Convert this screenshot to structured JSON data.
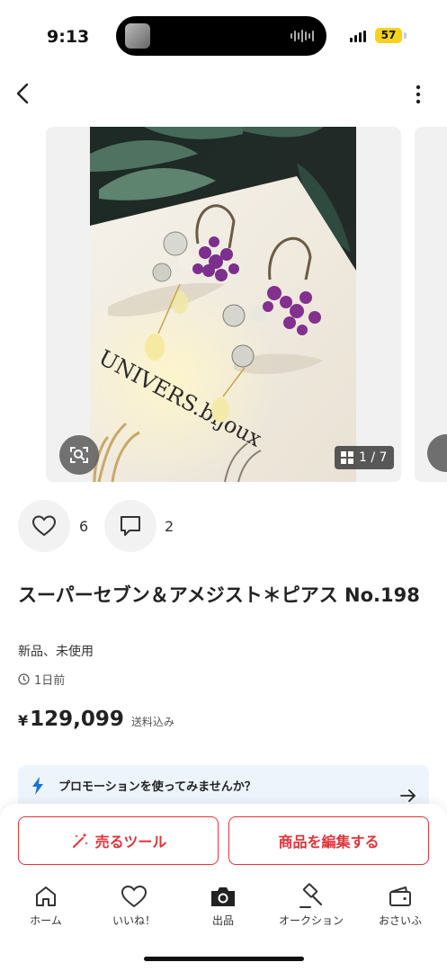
{
  "status_bar": {
    "time": "9:13",
    "battery": "57",
    "battery_color": "#f7d21a"
  },
  "nav": {
    "back_icon": "chevron-left-icon",
    "more_icon": "vertical-dots-icon"
  },
  "gallery": {
    "counter": "1 / 7",
    "current_index": 1,
    "total": 7,
    "card_text": "UNIVERS.bijoux",
    "image_search_icon": "image-search-icon"
  },
  "engagement": {
    "likes": "6",
    "comments": "2"
  },
  "product": {
    "title": "スーパーセブン＆アメジスト＊ピアス No.198",
    "condition": "新品、未使用",
    "posted": "1日前",
    "price_symbol": "¥",
    "price": "129,099",
    "shipping": "送料込み"
  },
  "promotion": {
    "text": "プロモーションを使ってみませんか？",
    "bolt_color": "#1673d9"
  },
  "actions": {
    "sell_tools": "売るツール",
    "edit_item": "商品を編集する",
    "accent_color": "#e0343b"
  },
  "tab_bar": {
    "items": [
      {
        "label": "ホーム",
        "icon": "home-icon"
      },
      {
        "label": "いいね！",
        "icon": "heart-icon"
      },
      {
        "label": "出品",
        "icon": "camera-icon"
      },
      {
        "label": "オークション",
        "icon": "gavel-icon"
      },
      {
        "label": "おさいふ",
        "icon": "wallet-icon"
      }
    ]
  }
}
